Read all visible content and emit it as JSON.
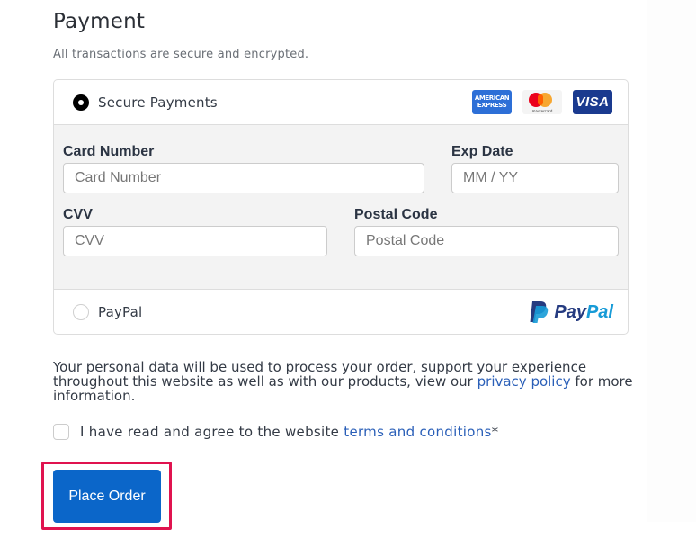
{
  "header": {
    "title": "Payment",
    "subtitle": "All transactions are secure and encrypted."
  },
  "payment_options": {
    "secure": {
      "label": "Secure Payments",
      "selected": true,
      "card_brands": [
        {
          "name": "amex",
          "text_line1": "AMERICAN",
          "text_line2": "EXPRESS"
        },
        {
          "name": "mastercard",
          "text": "mastercard"
        },
        {
          "name": "visa",
          "text": "VISA"
        }
      ]
    },
    "paypal": {
      "label": "PayPal",
      "selected": false,
      "logo_text_1": "Pay",
      "logo_text_2": "Pal"
    }
  },
  "card_form": {
    "card_number": {
      "label": "Card Number",
      "placeholder": "Card Number",
      "value": ""
    },
    "exp_date": {
      "label": "Exp Date",
      "placeholder": "MM / YY",
      "value": ""
    },
    "cvv": {
      "label": "CVV",
      "placeholder": "CVV",
      "value": ""
    },
    "postal_code": {
      "label": "Postal Code",
      "placeholder": "Postal Code",
      "value": ""
    }
  },
  "notice": {
    "text_before": "Your personal data will be used to process your order, support your experience throughout this website as well as with our products, view our ",
    "link": "privacy policy",
    "text_after": " for more information."
  },
  "agreement": {
    "checked": false,
    "text": "I have read and agree to the website ",
    "link": "terms and conditions",
    "required_mark": "*"
  },
  "actions": {
    "place_order_label": "Place Order"
  },
  "colors": {
    "primary_button": "#0b66c9",
    "link": "#2a5fb8",
    "highlight_border": "#e0134f",
    "form_background": "#f3f3f3"
  }
}
